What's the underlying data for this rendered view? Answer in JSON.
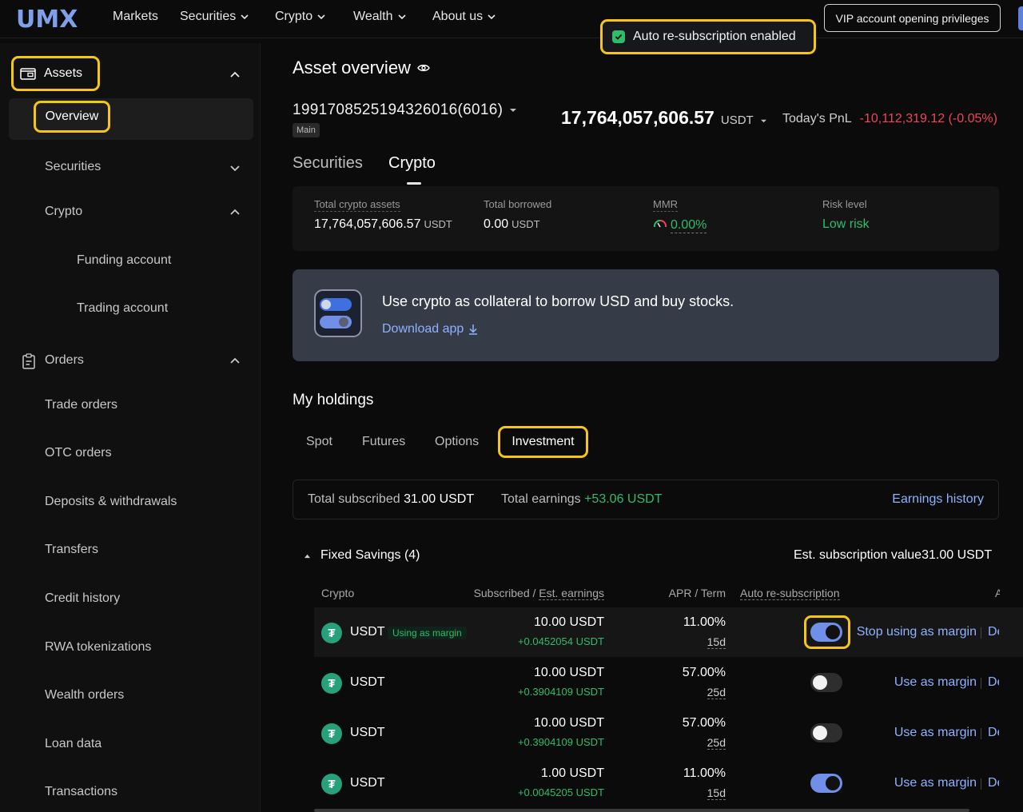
{
  "nav": {
    "logo": "UMX",
    "items": [
      "Markets",
      "Securities",
      "Crypto",
      "Wealth",
      "About us"
    ],
    "vip_button": "VIP account opening privileges"
  },
  "toast": {
    "text": "Auto re-subscription enabled",
    "icon": "check-icon"
  },
  "sidebar": {
    "assets": "Assets",
    "overview": "Overview",
    "securities": "Securities",
    "crypto": "Crypto",
    "funding_account": "Funding account",
    "trading_account": "Trading account",
    "orders": "Orders",
    "order_items": [
      "Trade orders",
      "OTC orders",
      "Deposits & withdrawals",
      "Transfers",
      "Credit history",
      "RWA tokenizations",
      "Wealth orders",
      "Loan data",
      "Transactions"
    ]
  },
  "overview": {
    "title": "Asset overview",
    "account_id": "19917085251943260​16(6016)",
    "account_badge": "Main",
    "balance": "17,764,057,606.57",
    "balance_unit": "USDT",
    "pnl_label": "Today's PnL",
    "pnl_value": "-10,112,319.12 (-0.05%)",
    "tabs": [
      "Securities",
      "Crypto"
    ]
  },
  "stats": {
    "total_crypto_label": "Total crypto assets",
    "total_crypto_value": "17,764,057,606.57",
    "total_crypto_unit": "USDT",
    "borrowed_label": "Total borrowed",
    "borrowed_value": "0.00",
    "borrowed_unit": "USDT",
    "mmr_label": "MMR",
    "mmr_value": "0.00%",
    "risk_label": "Risk level",
    "risk_value": "Low risk"
  },
  "banner": {
    "text": "Use crypto as collateral to borrow USD and buy stocks.",
    "link": "Download app"
  },
  "holdings": {
    "title": "My holdings",
    "tabs": [
      "Spot",
      "Futures",
      "Options",
      "Investment"
    ],
    "total_subscribed_label": "Total subscribed",
    "total_subscribed_value": "31.00 USDT",
    "total_earnings_label": "Total earnings",
    "total_earnings_value": "+53.06 USDT",
    "earnings_history": "Earnings history",
    "section_title": "Fixed Savings (4)",
    "est_value": "Est. subscription value31.00 USDT",
    "columns": {
      "crypto": "Crypto",
      "subscribed_a": "Subscribed /",
      "subscribed_b": "Est. earnings",
      "apr_a": "APR /",
      "apr_b": "Term",
      "auto": "Auto re-subscription",
      "cut": "A"
    },
    "rows": [
      {
        "coin": "USDT",
        "tag": "Using as margin",
        "subscribed": "10.00 USDT",
        "earnings": "+0.0452054 USDT",
        "apr": "11.00%",
        "term": "15d",
        "auto_on": true,
        "action": "Stop using as margin",
        "action2": "De"
      },
      {
        "coin": "USDT",
        "tag": "",
        "subscribed": "10.00 USDT",
        "earnings": "+0.3904109 USDT",
        "apr": "57.00%",
        "term": "25d",
        "auto_on": false,
        "action": "Use as margin",
        "action2": "De"
      },
      {
        "coin": "USDT",
        "tag": "",
        "subscribed": "10.00 USDT",
        "earnings": "+0.3904109 USDT",
        "apr": "57.00%",
        "term": "25d",
        "auto_on": false,
        "action": "Use as margin",
        "action2": "De"
      },
      {
        "coin": "USDT",
        "tag": "",
        "subscribed": "1.00 USDT",
        "earnings": "+0.0045205 USDT",
        "apr": "11.00%",
        "term": "15d",
        "auto_on": true,
        "action": "Use as margin",
        "action2": "De"
      }
    ]
  },
  "colors": {
    "accent": "#8fb1ff",
    "positive": "#2ebd6b",
    "negative": "#f0445a",
    "highlight": "#f5c518"
  }
}
